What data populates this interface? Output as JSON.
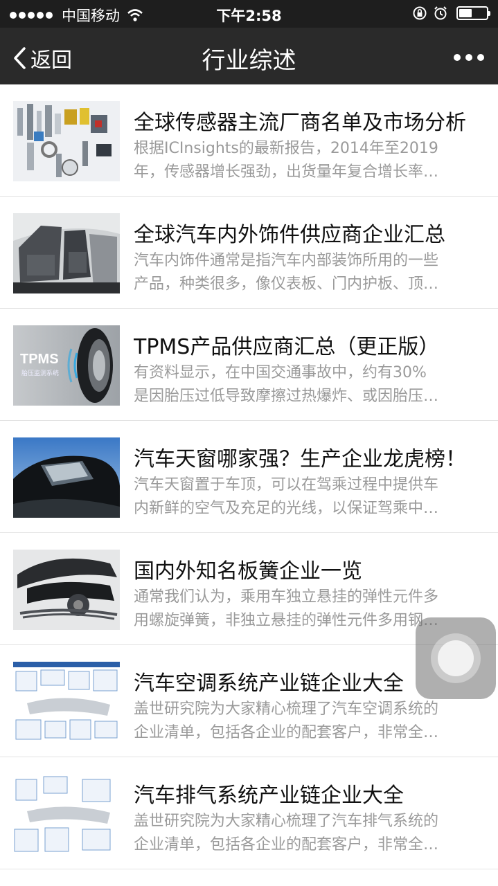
{
  "status_bar": {
    "carrier": "中国移动",
    "time": "下午2:58",
    "signal_icon": "signal-dots-icon",
    "wifi_icon": "wifi-icon",
    "lock_icon": "orientation-lock-icon",
    "alarm_icon": "alarm-icon",
    "battery_icon": "battery-icon",
    "battery_level": 0.42
  },
  "nav": {
    "back_label": "返回",
    "title": "行业综述",
    "more_icon": "more-dots-icon"
  },
  "articles": [
    {
      "title": "全球传感器主流厂商名单及市场分析",
      "desc_line1": "根据ICInsights的最新报告，2014年至2019",
      "desc_line2": "年，传感器增长强劲，出货量年复合增长率…",
      "thumb_icon": "sensors-thumbnail"
    },
    {
      "title": "全球汽车内外饰件供应商企业汇总",
      "desc_line1": "汽车内饰件通常是指汽车内部装饰所用的一些",
      "desc_line2": "产品，种类很多，像仪表板、门内护板、顶…",
      "thumb_icon": "car-interior-thumbnail"
    },
    {
      "title": "TPMS产品供应商汇总（更正版）",
      "desc_line1": "有资料显示，在中国交通事故中，约有30%",
      "desc_line2": "是因胎压过低导致摩擦过热爆炸、或因胎压…",
      "thumb_icon": "tpms-tire-thumbnail",
      "thumb_text": "TPMS",
      "thumb_subtext": "胎压监测系统"
    },
    {
      "title": "汽车天窗哪家强？生产企业龙虎榜！",
      "desc_line1": "汽车天窗置于车顶，可以在驾乘过程中提供车",
      "desc_line2": "内新鲜的空气及充足的光线，以保证驾乘中…",
      "thumb_icon": "sunroof-thumbnail"
    },
    {
      "title": "国内外知名板簧企业一览",
      "desc_line1": "通常我们认为，乘用车独立悬挂的弹性元件多",
      "desc_line2": "用螺旋弹簧，非独立悬挂的弹性元件多用钢…",
      "thumb_icon": "leaf-spring-thumbnail"
    },
    {
      "title": "汽车空调系统产业链企业大全",
      "desc_line1": "盖世研究院为大家精心梳理了汽车空调系统的",
      "desc_line2": "企业清单，包括各企业的配套客户，非常全…",
      "thumb_icon": "ac-system-diagram-thumbnail"
    },
    {
      "title": "汽车排气系统产业链企业大全",
      "desc_line1": "盖世研究院为大家精心梳理了汽车排气系统的",
      "desc_line2": "企业清单，包括各企业的配套客户，非常全…",
      "thumb_icon": "exhaust-system-diagram-thumbnail"
    }
  ],
  "assistive_touch": {
    "icon": "assistive-touch-icon"
  },
  "colors": {
    "status_bar_bg": "#1e1e1e",
    "nav_bg": "#2a2a2a",
    "title_text": "#111111",
    "desc_text": "#9a9a9a",
    "divider": "#e3e3e3"
  }
}
